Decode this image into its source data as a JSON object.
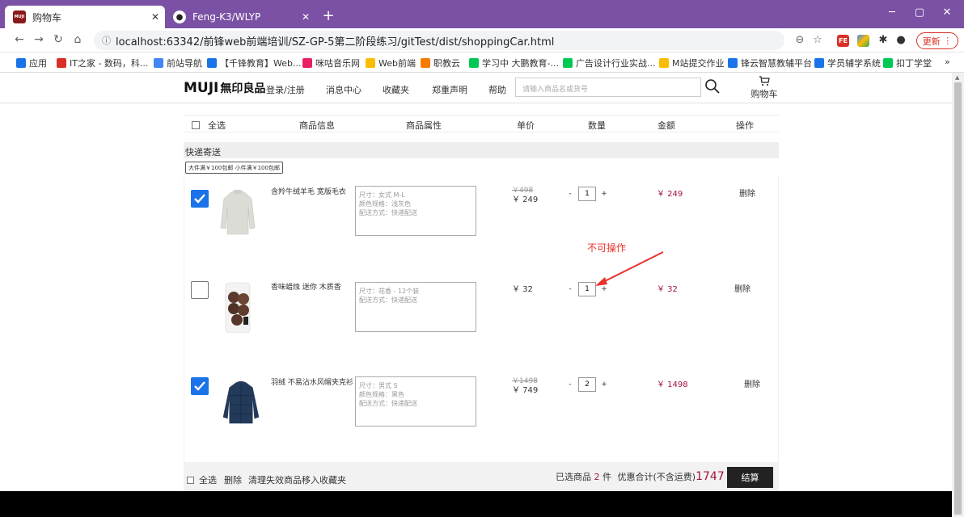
{
  "browser": {
    "tabs": [
      {
        "title": "购物车",
        "favicon": "MUJI",
        "active": true
      },
      {
        "title": "Feng-K3/WLYP",
        "favicon": "github",
        "active": false
      }
    ],
    "new_tab": "+",
    "url": "localhost:63342/前锋web前端培训/SZ-GP-5第二阶段练习/gitTest/dist/shoppingCar.html",
    "update_label": "更新",
    "bookmarks": [
      {
        "label": "应用",
        "color": "#1a73e8"
      },
      {
        "label": "IT之家 - 数码，科...",
        "color": "#d93025"
      },
      {
        "label": "前站导航",
        "color": "#4285f4"
      },
      {
        "label": "【千锋教育】Web...",
        "color": "#1a73e8"
      },
      {
        "label": "咪咕音乐网",
        "color": "#e91e63"
      },
      {
        "label": "Web前端",
        "color": "#fbbc04"
      },
      {
        "label": "职教云",
        "color": "#f57c00"
      },
      {
        "label": "学习中 大鹏教育-...",
        "color": "#00c853"
      },
      {
        "label": "广告设计行业实战...",
        "color": "#00c853"
      },
      {
        "label": "M站提交作业",
        "color": "#fbbc04"
      },
      {
        "label": "锋云智慧教辅平台",
        "color": "#1a73e8"
      },
      {
        "label": "学员辅学系统",
        "color": "#1a73e8"
      },
      {
        "label": "扣丁学堂",
        "color": "#00c853"
      }
    ],
    "more": "»"
  },
  "header": {
    "logo": "MUJI",
    "logo_cn": "無印良品",
    "nav": [
      "登录/注册",
      "消息中心",
      "收藏夹",
      "郑重声明",
      "帮助"
    ],
    "search_placeholder": "请输入商品名或货号",
    "cart_label": "购物车"
  },
  "table_header": {
    "select_all": "全选",
    "columns": [
      "商品信息",
      "商品属性",
      "单价",
      "数量",
      "金额",
      "操作"
    ]
  },
  "group": {
    "title": "快递寄送",
    "promo": "大件满￥100包邮 小件满￥100包邮"
  },
  "items": [
    {
      "checked": true,
      "name": "含羚牛绒羊毛 宽版毛衣",
      "attrs": [
        "尺寸：女式 M-L",
        "颜色规格：浅灰色",
        "配送方式：快递配送"
      ],
      "old_price": "￥498",
      "price": "￥ 249",
      "qty": "1",
      "amount": "￥ 249",
      "delete": "删除"
    },
    {
      "checked": false,
      "name": "香味蜡烛 迷你 木质香",
      "attrs": [
        "尺寸：花香 - 12个装",
        "配送方式：快递配送"
      ],
      "old_price": "",
      "price": "￥ 32",
      "qty": "1",
      "amount": "￥ 32",
      "delete": "删除"
    },
    {
      "checked": true,
      "name": "羽绒 不易沾水风帽夹克衫",
      "attrs": [
        "尺寸：男式 S",
        "颜色规格：黑色",
        "配送方式：快递配送"
      ],
      "old_price": "￥1498",
      "price": "￥ 749",
      "qty": "2",
      "amount": "￥ 1498",
      "delete": "删除"
    }
  ],
  "qty_controls": {
    "minus": "-",
    "plus": "+"
  },
  "annotation": "不可操作",
  "footer": {
    "select_all": "全选",
    "delete": "删除",
    "clear_invalid": "清理失效商品",
    "move_to_fav": "移入收藏夹",
    "selected_prefix": "已选商品",
    "selected_count": "2",
    "selected_suffix": "件",
    "total_label": "优惠合计(不含运费)",
    "total": "1747",
    "checkout": "结算"
  },
  "colors": {
    "accent_red": "#a0143a",
    "checkbox_blue": "#1a73e8",
    "tabbar_purple": "#7a51a4"
  }
}
